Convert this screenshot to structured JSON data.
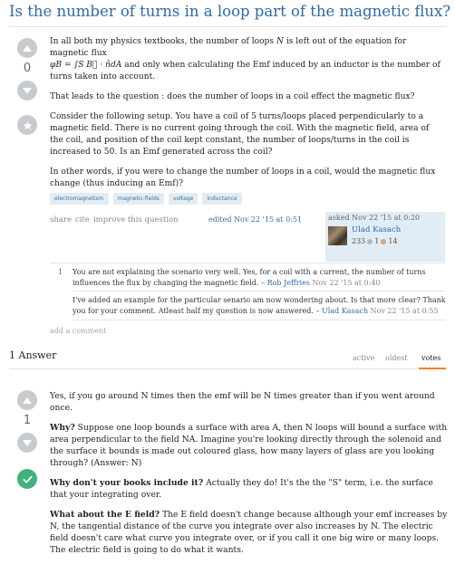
{
  "question": {
    "title": "Is the number of turns in a loop part of the magnetic flux?",
    "vote_count": "0",
    "body": {
      "p1_pre": "In all both my physics textbooks, the number of loops",
      "p1_N": "N",
      "p1_post": "is left out of the equation for magnetic flux",
      "formula": "φB = ∫S B⃗ · n̂dA",
      "p1_end": "and only when calculating the Emf induced by an inductor is the number of turns taken into account.",
      "p2": "That leads to the question : does the number of loops in a coil effect the magnetic flux?",
      "p3": "Consider the following setup. You have a coil of 5 turns/loops placed perpendicularly to a magnetic field. There is no current going through the coil. With the magnetic field, area of the coil, and position of the coil kept constant, the number of loops/turns in the coil is increased to 50. Is an Emf generated across the coil?",
      "p4": "In other words, if you were to change the number of loops in a coil, would the magnetic flux change (thus inducing an Emf)?"
    },
    "tags": [
      "electromagnetism",
      "magnetic-fields",
      "voltage",
      "inductance"
    ],
    "menu": {
      "share": "share",
      "cite": "cite",
      "improve": "improve this question"
    },
    "edited": "edited Nov 22 '15 at 0:51",
    "asked": {
      "label": "asked Nov 22 '15 at 0:20",
      "user": "Ulad Kasach",
      "rep": "233",
      "silver": "1",
      "bronze": "14"
    }
  },
  "comments": [
    {
      "score": "1",
      "text": "You are not explaining the scenario very well. Yes, for a coil with a current, the number of turns influences the flux by changing the magnetic field. –",
      "user": "Rob Jeffries",
      "time": "Nov 22 '15 at 0:40"
    },
    {
      "score": "",
      "text": "I've added an example for the particular senario am now wondering about. Is that more clear? Thank you for your comment. Atleast half my question is now answered. –",
      "user": "Ulad Kasach",
      "time": "Nov 22 '15 at 0:55"
    }
  ],
  "add_comment": "add a comment",
  "answers_header": "1 Answer",
  "sort_tabs": [
    "active",
    "oldest",
    "votes"
  ],
  "answer": {
    "vote_count": "1",
    "p1": "Yes, if you go around N times then the emf will be N times greater than if you went around once.",
    "p2_bold": "Why?",
    "p2": "Suppose one loop bounds a surface with area A, then N loops will bound a surface with area perpendicular to the field NA. Imagine you're looking directly through the solenoid and the surface it bounds is made out coloured glass, how many layers of glass are you looking through? (Answer: N)",
    "p3_bold": "Why don't your books include it?",
    "p3": "Actually they do! It's the the \"S\" term, i.e. the surface that your integrating over.",
    "p4_bold": "What about the E field?",
    "p4": "The E field doesn't change because although your emf increases by N, the tangential distance of the curve you integrate over also increases by N. The electric field doesn't care what curve you integrate over, or if you call it one big wire or many loops. The electric field is going to do what it wants."
  },
  "colors": {
    "link": "#2e6aa8",
    "tag_bg": "#e3ecf3",
    "accepted": "#3fb37a",
    "sort_active": "#f48024"
  }
}
